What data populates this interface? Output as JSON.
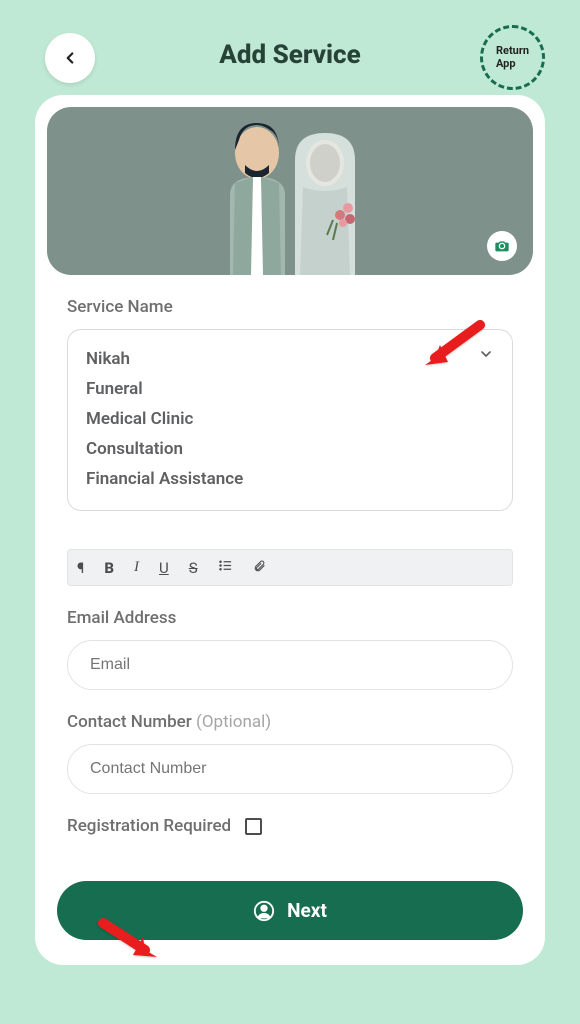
{
  "header": {
    "title": "Add Service",
    "returnApp": "Return\nApp"
  },
  "form": {
    "serviceNameLabel": "Service Name",
    "options": {
      "o0": "Nikah",
      "o1": "Funeral",
      "o2": "Medical Clinic",
      "o3": "Consultation",
      "o4": "Financial Assistance"
    },
    "emailLabel": "Email Address",
    "emailPlaceholder": "Email",
    "contactLabel": "Contact Number",
    "contactOptional": "(Optional)",
    "contactPlaceholder": "Contact Number",
    "registrationLabel": "Registration Required"
  },
  "nextLabel": "Next",
  "colors": {
    "accent": "#176d4f",
    "bg": "#bfe9d4"
  }
}
